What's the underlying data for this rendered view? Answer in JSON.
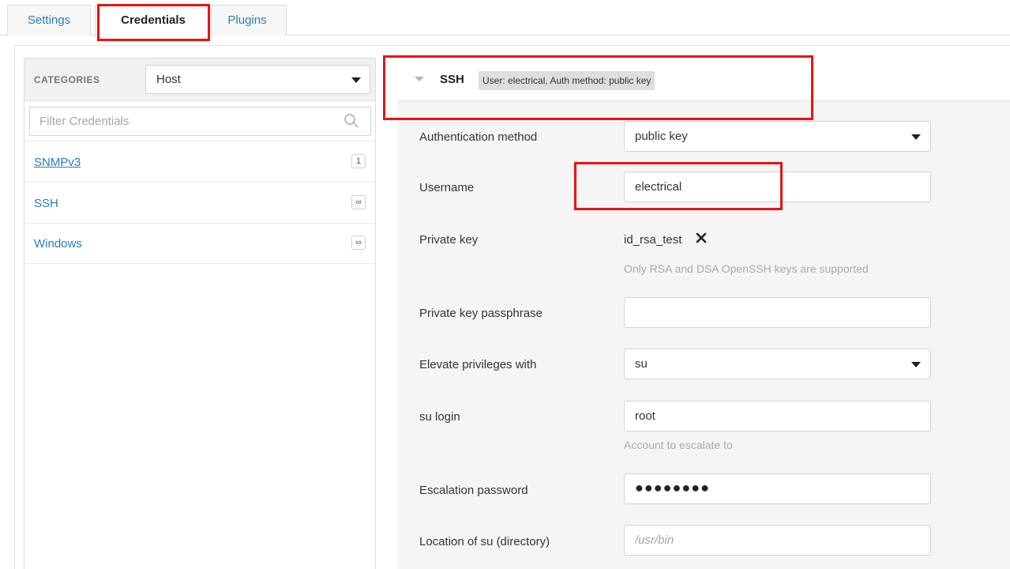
{
  "tabs": [
    {
      "label": "Settings",
      "active": false
    },
    {
      "label": "Credentials",
      "active": true
    },
    {
      "label": "Plugins",
      "active": false
    }
  ],
  "sidebar": {
    "categories_label": "CATEGORIES",
    "category_value": "Host",
    "filter_placeholder": "Filter Credentials",
    "items": [
      {
        "name": "SNMPv3",
        "badge": "1"
      },
      {
        "name": "SSH",
        "badge": "∞"
      },
      {
        "name": "Windows",
        "badge": "∞"
      }
    ]
  },
  "section": {
    "title": "SSH",
    "summary": "User: electrical, Auth method: public key"
  },
  "form": {
    "auth_method": {
      "label": "Authentication method",
      "value": "public key"
    },
    "username": {
      "label": "Username",
      "value": "electrical"
    },
    "private_key": {
      "label": "Private key",
      "file": "id_rsa_test",
      "help": "Only RSA and DSA OpenSSH keys are supported"
    },
    "passphrase": {
      "label": "Private key passphrase",
      "value": ""
    },
    "elevate": {
      "label": "Elevate privileges with",
      "value": "su"
    },
    "su_login": {
      "label": "su login",
      "value": "root",
      "help": "Account to escalate to"
    },
    "escalation_password": {
      "label": "Escalation password",
      "masked": "●●●●●●●●"
    },
    "su_location": {
      "label": "Location of su (directory)",
      "placeholder": "/usr/bin"
    }
  },
  "colors": {
    "link": "#2a7bb8",
    "highlight": "#ee1111",
    "content_bg": "#f5f5f5"
  }
}
